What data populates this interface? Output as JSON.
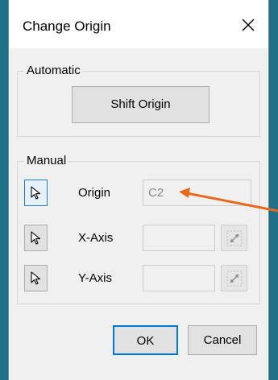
{
  "window": {
    "title": "Change Origin"
  },
  "automatic": {
    "legend": "Automatic",
    "shift_origin_label": "Shift Origin"
  },
  "manual": {
    "legend": "Manual",
    "rows": [
      {
        "label": "Origin",
        "value": "C2",
        "active": true
      },
      {
        "label": "X-Axis",
        "value": "",
        "active": false
      },
      {
        "label": "Y-Axis",
        "value": "",
        "active": false
      }
    ]
  },
  "footer": {
    "ok_label": "OK",
    "cancel_label": "Cancel"
  },
  "icons": {
    "close": "close-icon",
    "pick": "cursor-pick-icon",
    "swap": "swap-axis-icon"
  },
  "colors": {
    "desktop_background": "#1f6f86",
    "annotation_arrow": "#e8691e",
    "focus_border": "#0078d7"
  }
}
